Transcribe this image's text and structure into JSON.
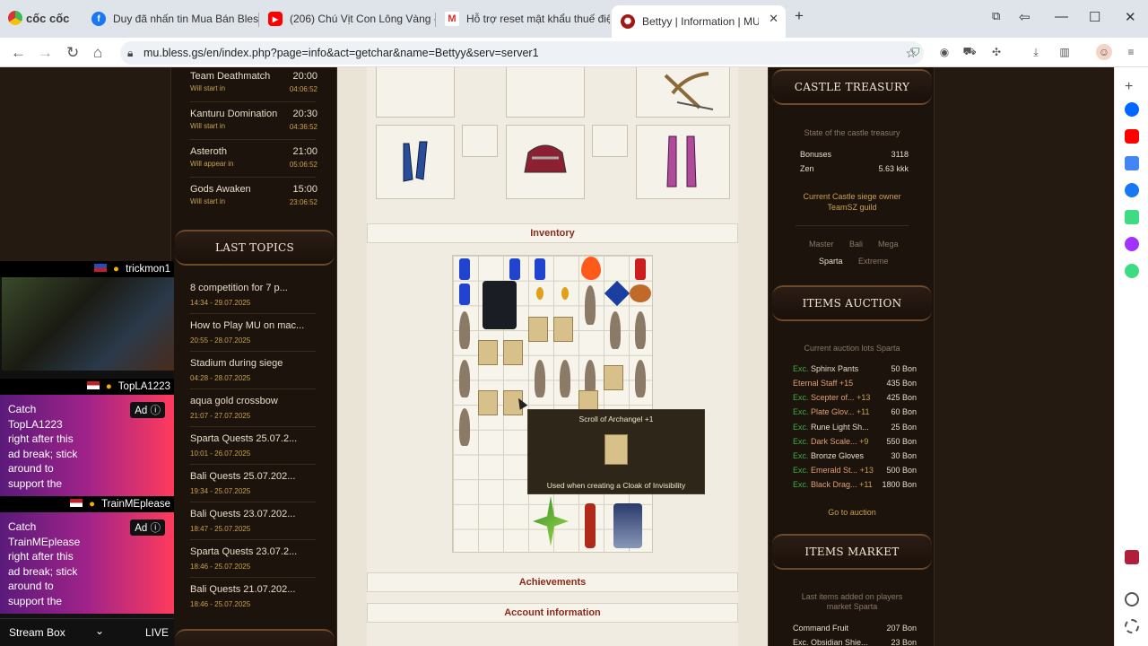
{
  "browser": {
    "brand": "cốc cốc",
    "tabs": [
      {
        "label": "Duy đã nhấn tin Mua Bán Bless",
        "icon": "facebook-icon",
        "color": "#1877f2"
      },
      {
        "label": "(206) Chú Vịt Con Lông Vàng - N",
        "icon": "youtube-icon",
        "color": "#ff0000"
      },
      {
        "label": "Hỗ trợ reset mật khẩu thuế điện",
        "icon": "gmail-icon",
        "color": "#d93025"
      },
      {
        "label": "Bettyy | Information | MU Bl",
        "icon": "site-icon",
        "color": "#a01818"
      }
    ],
    "url": "mu.bless.gs/en/index.php?page=info&act=getchar&name=Bettyy&serv=server1"
  },
  "events": [
    {
      "name": "Team Deathmatch",
      "time": "20:00",
      "status": "Will start in",
      "countdown": "04:06:52"
    },
    {
      "name": "Kanturu Domination",
      "time": "20:30",
      "status": "Will start in",
      "countdown": "04:36:52"
    },
    {
      "name": "Asteroth",
      "time": "21:00",
      "status": "Will appear in",
      "countdown": "05:06:52"
    },
    {
      "name": "Gods Awaken",
      "time": "15:00",
      "status": "Will start in",
      "countdown": "23:06:52"
    }
  ],
  "last_topics": {
    "title": "LAST TOPICS",
    "items": [
      {
        "title": "8 competition for 7 p...",
        "date": "14:34 - 29.07.2025"
      },
      {
        "title": "How to Play MU on mac...",
        "date": "20:55 - 28.07.2025"
      },
      {
        "title": "Stadium during siege",
        "date": "04:28 - 28.07.2025"
      },
      {
        "title": "aqua gold crossbow",
        "date": "21:07 - 27.07.2025"
      },
      {
        "title": "Sparta Quests 25.07.2...",
        "date": "10:01 - 26.07.2025"
      },
      {
        "title": "Bali Quests 25.07.202...",
        "date": "19:34 - 25.07.2025"
      },
      {
        "title": "Bali Quests 23.07.202...",
        "date": "18:47 - 25.07.2025"
      },
      {
        "title": "Sparta Quests 23.07.2...",
        "date": "18:46 - 25.07.2025"
      },
      {
        "title": "Bali Quests 21.07.202...",
        "date": "18:46 - 25.07.2025"
      }
    ]
  },
  "center": {
    "inventory_title": "Inventory",
    "achievements_title": "Achievements",
    "account_title": "Account information",
    "tooltip": {
      "title": "Scroll of Archangel +1",
      "desc": "Used when creating a Cloak of Invisibility"
    }
  },
  "castle": {
    "title": "CASTLE TREASURY",
    "subtitle": "State of the castle treasury",
    "bonuses_label": "Bonuses",
    "bonuses_value": "3118",
    "zen_label": "Zen",
    "zen_value": "5.63 kkk",
    "owner_line1": "Current Castle siege owner",
    "owner_line2": "TeamSZ guild",
    "servers": [
      "Master",
      "Bali",
      "Mega",
      "Sparta",
      "Extreme"
    ]
  },
  "auction": {
    "title": "ITEMS AUCTION",
    "subtitle": "Current auction lots Sparta",
    "items": [
      {
        "prefix": "Exc.",
        "name": "Sphinx Pants",
        "suffix": "",
        "price": "50 Bon"
      },
      {
        "prefix": "",
        "name": "Eternal Staff +15",
        "suffix": "",
        "price": "435 Bon"
      },
      {
        "prefix": "Exc.",
        "name": "Scepter of...",
        "suffix": " +13",
        "price": "425 Bon"
      },
      {
        "prefix": "Exc.",
        "name": "Plate Glov...",
        "suffix": " +11",
        "price": "60 Bon"
      },
      {
        "prefix": "Exc.",
        "name": "Rune Light Sh...",
        "suffix": "",
        "price": "25 Bon"
      },
      {
        "prefix": "Exc.",
        "name": "Dark Scale...",
        "suffix": " +9",
        "price": "550 Bon"
      },
      {
        "prefix": "Exc.",
        "name": "Bronze Gloves",
        "suffix": "",
        "price": "30 Bon"
      },
      {
        "prefix": "Exc.",
        "name": "Emerald St...",
        "suffix": " +13",
        "price": "500 Bon"
      },
      {
        "prefix": "Exc.",
        "name": "Black Drag...",
        "suffix": " +11",
        "price": "1800 Bon"
      }
    ],
    "link": "Go to auction"
  },
  "market": {
    "title": "ITEMS MARKET",
    "subtitle1": "Last items added on players",
    "subtitle2": "market Sparta",
    "items": [
      {
        "name": "Command Fruit",
        "price": "207 Bon"
      },
      {
        "name": "Exc. Obsidian Shie...",
        "price": "23 Bon"
      }
    ]
  },
  "stream": {
    "user1": "trickmon1",
    "user2": "TopLA1223",
    "user3": "TrainMEplease",
    "ad1": "Catch\nTopLA1223\nright after this\nad break; stick\naround to\nsupport the",
    "ad2": "Catch\nTrainMEplease\nright after this\nad break; stick\naround to\nsupport the",
    "ad_badge": "Ad",
    "streambox": "Stream Box",
    "live": "LIVE"
  }
}
